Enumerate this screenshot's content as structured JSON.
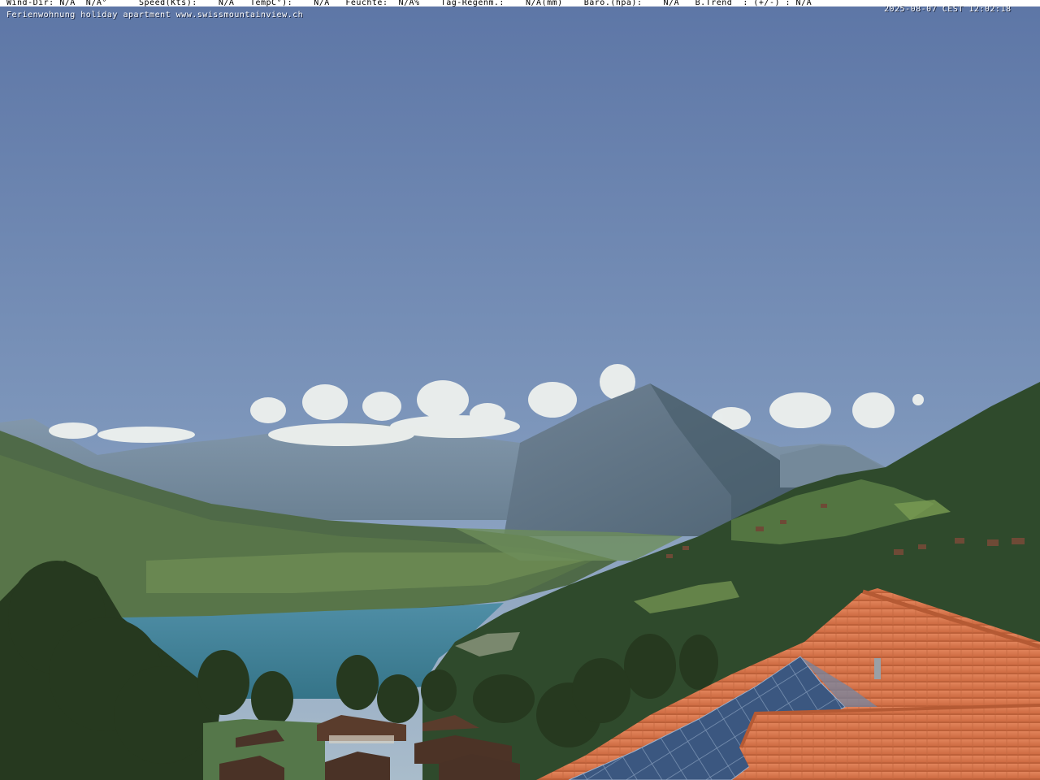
{
  "overlay": {
    "weather_line": "Wind-Dir: N/A  N/A°      Speed(Kts):    N/A   TempC°):    N/A   Feuchte:  N/A%    Tag-Regenm.:    N/A(mm)    Baro.(hpa):    N/A   B.Trend  : (+/-) : N/A",
    "timestamp": "2025-08-07 CEST 12:02:18",
    "caption": "Ferienwohnung holiday apartment www.swissmountainview.ch"
  },
  "colors": {
    "sky_top": "#5e77a6",
    "sky_bottom": "#9bb0c5",
    "lake": "#3f7f98",
    "roof_tile": "#d8744a",
    "solar_panel": "#3d5a82",
    "forest": "#2d4a2a"
  },
  "scene_elements": {
    "mountain_peak": "pyramid-mountain",
    "lake": "lake",
    "roof": "tiled-roof-with-solar-panels"
  }
}
